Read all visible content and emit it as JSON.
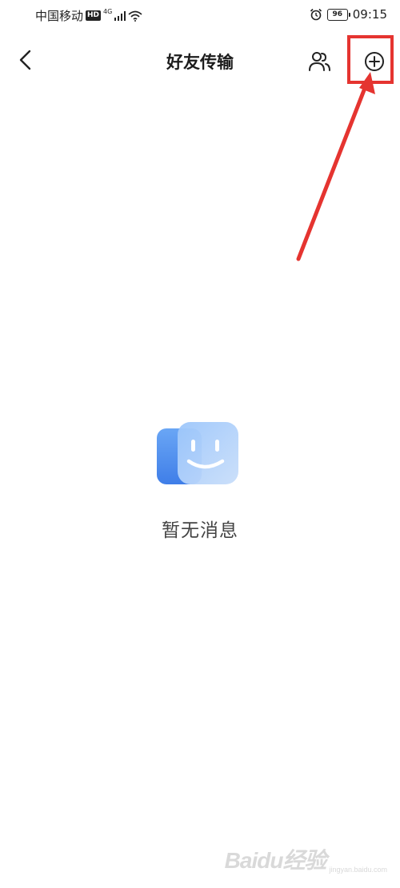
{
  "status_bar": {
    "carrier": "中国移动",
    "hd_badge": "HD",
    "network_type": "4G",
    "signal_icon": "signal-bars-icon",
    "wifi_icon": "wifi-icon",
    "alarm_icon": "alarm-clock-icon",
    "battery_level": "96",
    "time": "09:15"
  },
  "header": {
    "back_icon": "chevron-left-icon",
    "title": "好友传输",
    "friends_icon": "user-group-icon",
    "add_icon": "plus-circle-icon"
  },
  "empty_state": {
    "illustration_icon": "smiley-face-icon",
    "message": "暂无消息"
  },
  "annotation": {
    "color": "#e53430",
    "target": "add-button"
  },
  "watermark": {
    "logo": "Baidu经验",
    "sub": "jingyan.baidu.com"
  },
  "colors": {
    "accent_blue": "#4c8ef0",
    "annotation_red": "#e53430"
  }
}
